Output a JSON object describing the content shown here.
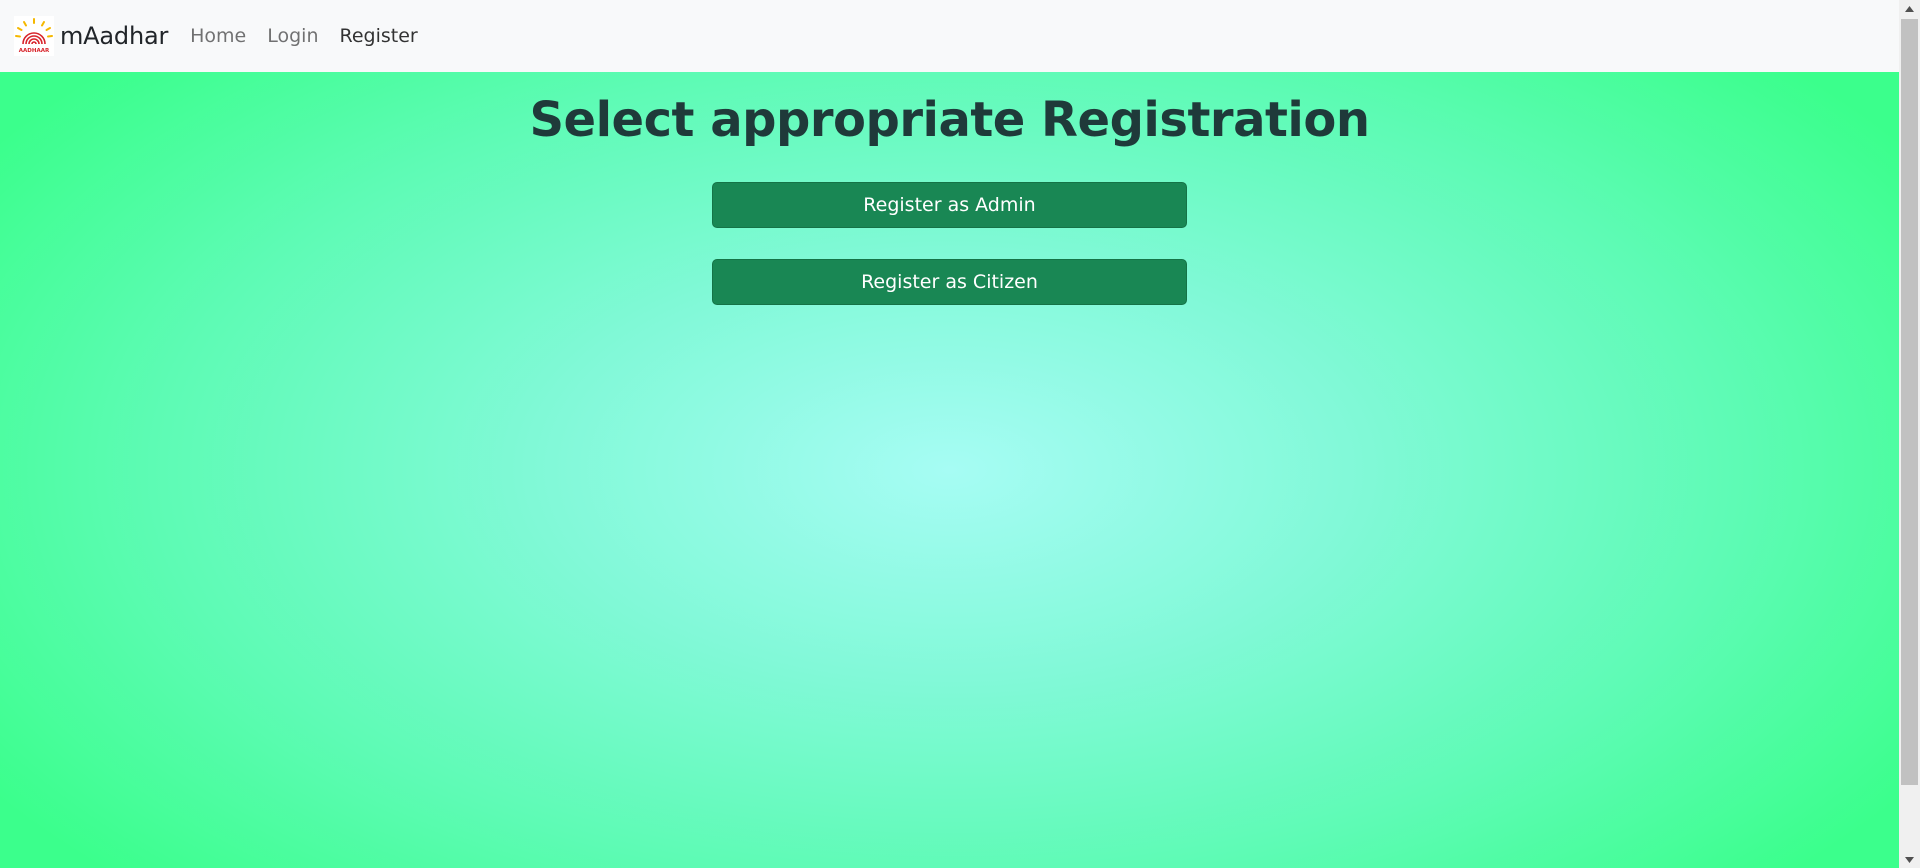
{
  "navbar": {
    "brand_name": "mAadhar",
    "logo_text": "AADHAAR",
    "links": [
      {
        "label": "Home"
      },
      {
        "label": "Login"
      },
      {
        "label": "Register"
      }
    ]
  },
  "main": {
    "title": "Select appropriate Registration",
    "buttons": {
      "admin_label": "Register as Admin",
      "citizen_label": "Register as Citizen"
    }
  },
  "colors": {
    "button_bg": "#198754",
    "navbar_bg": "#f8f9fa",
    "gradient_center": "#a6fcf4",
    "gradient_edge": "#3bff8c"
  },
  "icons": {
    "logo": "aadhaar-logo-icon",
    "scroll_up": "chevron-up-icon",
    "scroll_down": "chevron-down-icon"
  }
}
